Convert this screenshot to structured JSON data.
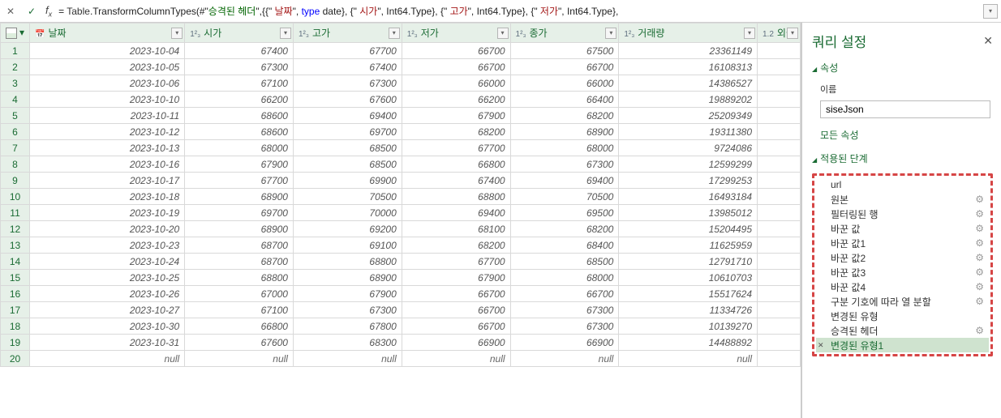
{
  "formula_bar": {
    "prefix": "= ",
    "parts": [
      {
        "t": "Table",
        "c": "fn"
      },
      {
        "t": ".TransformColumnTypes(#\"",
        "c": ""
      },
      {
        "t": "승격된 헤더",
        "c": "str-green"
      },
      {
        "t": "\",{{\" ",
        "c": ""
      },
      {
        "t": "날짜",
        "c": "str-red"
      },
      {
        "t": "\", ",
        "c": ""
      },
      {
        "t": "type",
        "c": "kw-type"
      },
      {
        "t": " date}, {\" ",
        "c": ""
      },
      {
        "t": "시가",
        "c": "str-red"
      },
      {
        "t": "\", Int64.Type}, {\" ",
        "c": ""
      },
      {
        "t": "고가",
        "c": "str-red"
      },
      {
        "t": "\", Int64.Type}, {\" ",
        "c": ""
      },
      {
        "t": "저가",
        "c": "str-red"
      },
      {
        "t": "\", Int64.Type},",
        "c": ""
      }
    ]
  },
  "columns": [
    {
      "name": "날짜",
      "type_icon": "📅",
      "type_class": "date"
    },
    {
      "name": "시가",
      "type_icon": "1²₃",
      "type_class": "num"
    },
    {
      "name": "고가",
      "type_icon": "1²₃",
      "type_class": "num"
    },
    {
      "name": "저가",
      "type_icon": "1²₃",
      "type_class": "num"
    },
    {
      "name": "종가",
      "type_icon": "1²₃",
      "type_class": "num"
    },
    {
      "name": "거래량",
      "type_icon": "1²₃",
      "type_class": "num"
    },
    {
      "name": "외국",
      "type_icon": "1.2",
      "type_class": "num",
      "narrow": true
    }
  ],
  "rows": [
    [
      "2023-10-04",
      "67400",
      "67700",
      "66700",
      "67500",
      "23361149"
    ],
    [
      "2023-10-05",
      "67300",
      "67400",
      "66700",
      "66700",
      "16108313"
    ],
    [
      "2023-10-06",
      "67100",
      "67300",
      "66000",
      "66000",
      "14386527"
    ],
    [
      "2023-10-10",
      "66200",
      "67600",
      "66200",
      "66400",
      "19889202"
    ],
    [
      "2023-10-11",
      "68600",
      "69400",
      "67900",
      "68200",
      "25209349"
    ],
    [
      "2023-10-12",
      "68600",
      "69700",
      "68200",
      "68900",
      "19311380"
    ],
    [
      "2023-10-13",
      "68000",
      "68500",
      "67700",
      "68000",
      "9724086"
    ],
    [
      "2023-10-16",
      "67900",
      "68500",
      "66800",
      "67300",
      "12599299"
    ],
    [
      "2023-10-17",
      "67700",
      "69900",
      "67400",
      "69400",
      "17299253"
    ],
    [
      "2023-10-18",
      "68900",
      "70500",
      "68800",
      "70500",
      "16493184"
    ],
    [
      "2023-10-19",
      "69700",
      "70000",
      "69400",
      "69500",
      "13985012"
    ],
    [
      "2023-10-20",
      "68900",
      "69200",
      "68100",
      "68200",
      "15204495"
    ],
    [
      "2023-10-23",
      "68700",
      "69100",
      "68200",
      "68400",
      "11625959"
    ],
    [
      "2023-10-24",
      "68700",
      "68800",
      "67700",
      "68500",
      "12791710"
    ],
    [
      "2023-10-25",
      "68800",
      "68900",
      "67900",
      "68000",
      "10610703"
    ],
    [
      "2023-10-26",
      "67000",
      "67900",
      "66700",
      "66700",
      "15517624"
    ],
    [
      "2023-10-27",
      "67100",
      "67300",
      "66700",
      "67300",
      "11334726"
    ],
    [
      "2023-10-30",
      "66800",
      "67800",
      "66700",
      "67300",
      "10139270"
    ],
    [
      "2023-10-31",
      "67600",
      "68300",
      "66900",
      "66900",
      "14488892"
    ],
    [
      "null",
      "null",
      "null",
      "null",
      "null",
      "null"
    ]
  ],
  "side": {
    "title": "쿼리 설정",
    "section_props": "속성",
    "name_label": "이름",
    "name_value": "siseJson",
    "all_props_link": "모든 속성",
    "section_steps": "적용된 단계",
    "steps": [
      {
        "label": "url",
        "gear": false
      },
      {
        "label": "원본",
        "gear": true
      },
      {
        "label": "필터링된 행",
        "gear": true
      },
      {
        "label": "바꾼 값",
        "gear": true
      },
      {
        "label": "바꾼 값1",
        "gear": true
      },
      {
        "label": "바꾼 값2",
        "gear": true
      },
      {
        "label": "바꾼 값3",
        "gear": true
      },
      {
        "label": "바꾼 값4",
        "gear": true
      },
      {
        "label": "구분 기호에 따라 열 분할",
        "gear": true
      },
      {
        "label": "변경된 유형",
        "gear": false
      },
      {
        "label": "승격된 헤더",
        "gear": true
      },
      {
        "label": "변경된 유형1",
        "gear": false,
        "selected": true
      }
    ]
  }
}
